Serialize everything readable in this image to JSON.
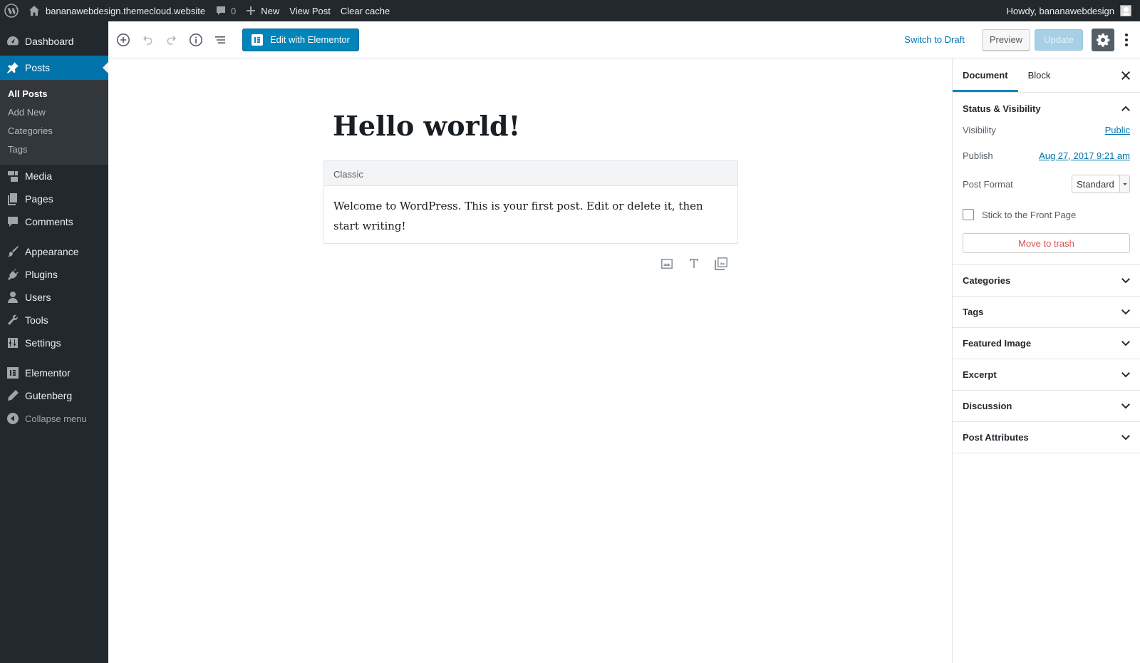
{
  "adminbar": {
    "site_name": "bananawebdesign.themecloud.website",
    "comments_count": "0",
    "new_label": "New",
    "view_post": "View Post",
    "clear_cache": "Clear cache",
    "howdy": "Howdy, bananawebdesign"
  },
  "menu": {
    "dashboard": "Dashboard",
    "posts": "Posts",
    "posts_sub": [
      "All Posts",
      "Add New",
      "Categories",
      "Tags"
    ],
    "media": "Media",
    "pages": "Pages",
    "comments": "Comments",
    "appearance": "Appearance",
    "plugins": "Plugins",
    "users": "Users",
    "tools": "Tools",
    "settings": "Settings",
    "elementor": "Elementor",
    "gutenberg": "Gutenberg",
    "collapse": "Collapse menu"
  },
  "header": {
    "elementor_button": "Edit with Elementor",
    "switch_to_draft": "Switch to Draft",
    "preview": "Preview",
    "update": "Update"
  },
  "post": {
    "title": "Hello world!",
    "block_label": "Classic",
    "body": "Welcome to WordPress. This is your first post. Edit or delete it, then start writing!"
  },
  "sidebar": {
    "tabs": [
      "Document",
      "Block"
    ],
    "status_panel": {
      "title": "Status & Visibility",
      "visibility_label": "Visibility",
      "visibility_value": "Public",
      "publish_label": "Publish",
      "publish_value": "Aug 27, 2017 9:21 am",
      "format_label": "Post Format",
      "format_value": "Standard",
      "sticky_label": "Stick to the Front Page",
      "trash": "Move to trash"
    },
    "panels": [
      "Categories",
      "Tags",
      "Featured Image",
      "Excerpt",
      "Discussion",
      "Post Attributes"
    ]
  },
  "colors": {
    "admin_dark": "#23282d",
    "accent": "#0073aa",
    "primary_button": "#0085ba",
    "danger": "#d94f4f"
  }
}
